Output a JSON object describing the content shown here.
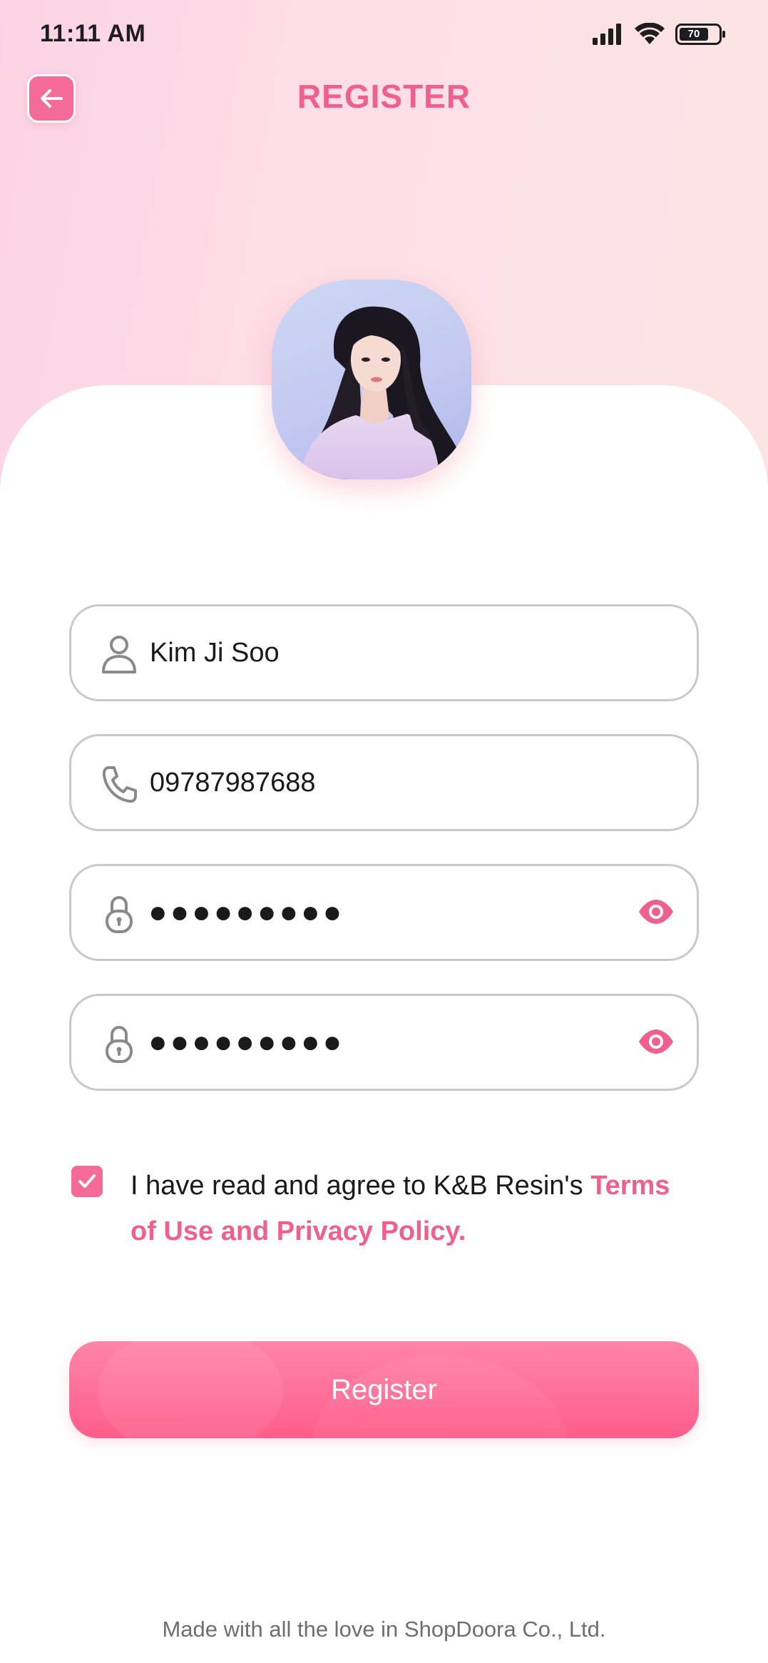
{
  "status_bar": {
    "time": "11:11 AM",
    "battery": "70"
  },
  "header": {
    "title": "REGISTER",
    "back_icon": "arrow-left-icon"
  },
  "profile": {
    "avatar_alt": "avatar"
  },
  "form": {
    "name_value": "Kim Ji Soo",
    "phone_value": "09787987688",
    "password_value": "●●●●●●●●●",
    "confirm_password_value": "●●●●●●●●●"
  },
  "agreement": {
    "checked": true,
    "text": "I have read and agree to K&B Resin's ",
    "link": "Terms of Use and Privacy Policy."
  },
  "actions": {
    "register_label": "Register"
  },
  "footer": {
    "text": "Made with all the love in ShopDoora Co., Ltd."
  },
  "colors": {
    "accent": "#f46a98",
    "title": "#f0608e",
    "button_top": "#ff85a8",
    "button_bottom": "#ff5d8c",
    "background_top": "#fcd3e6"
  }
}
